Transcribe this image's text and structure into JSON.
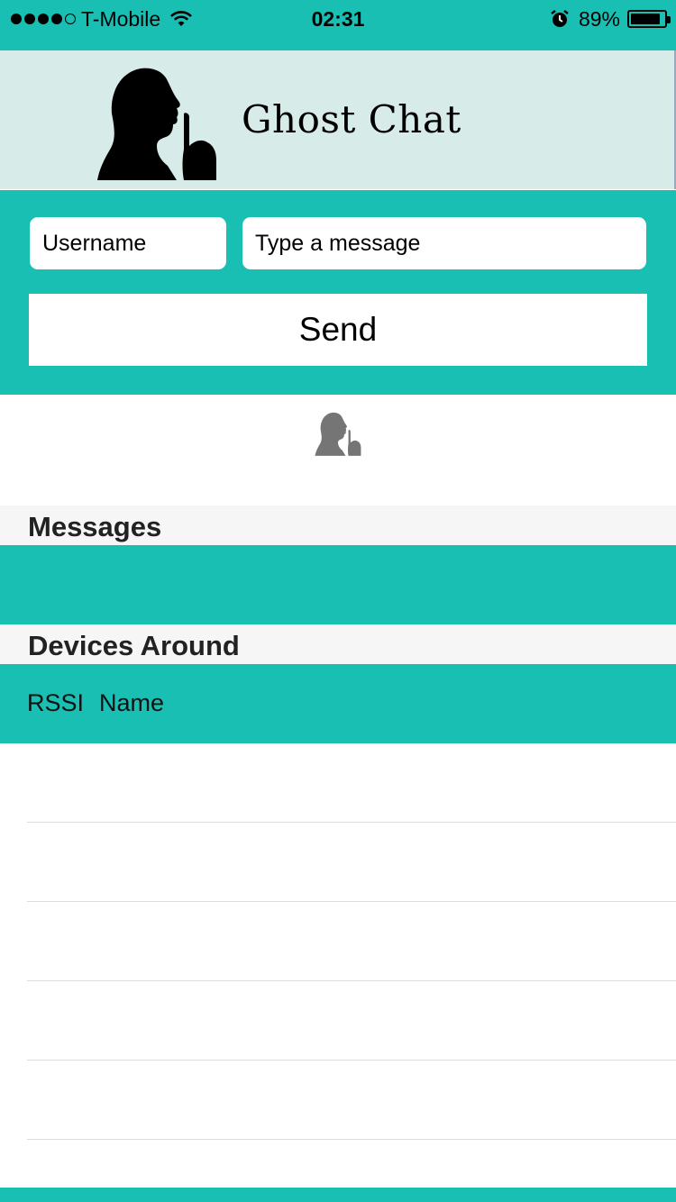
{
  "status_bar": {
    "carrier": "T-Mobile",
    "time": "02:31",
    "battery_percent": "89%",
    "battery_level": 0.89,
    "signal_bars": 4,
    "signal_max": 5,
    "icons": [
      "signal-dots-icon",
      "wifi-icon",
      "alarm-icon",
      "battery-icon"
    ]
  },
  "header": {
    "title": "Ghost Chat",
    "logo_icon": "silhouette-shush-icon"
  },
  "compose": {
    "username_placeholder": "Username",
    "message_placeholder": "Type a message",
    "send_label": "Send"
  },
  "sections": {
    "messages_title": "Messages",
    "devices_title": "Devices Around",
    "devices_columns": [
      "RSSI",
      "Name"
    ]
  },
  "colors": {
    "accent": "#1abfb4",
    "banner": "#d7ebe8",
    "section_header": "#f6f6f6"
  }
}
